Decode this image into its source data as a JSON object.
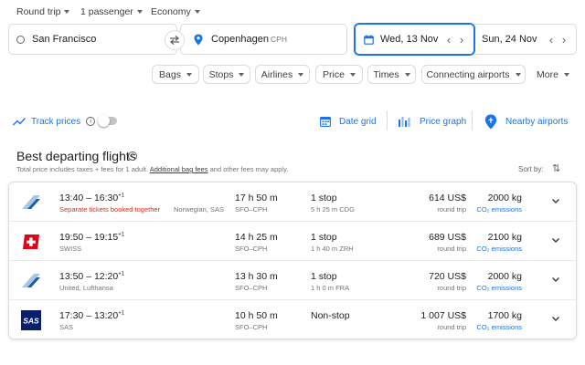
{
  "search": {
    "trip_type": "Round trip",
    "passengers": "1 passenger",
    "cabin": "Economy",
    "origin": "San Francisco",
    "destination": "Copenhagen",
    "destination_code": "CPH",
    "depart_date": "Wed, 13 Nov",
    "return_date": "Sun, 24 Nov"
  },
  "filters": [
    "Bags",
    "Stops",
    "Airlines",
    "Price",
    "Times",
    "Connecting airports",
    "More"
  ],
  "tools": {
    "track_prices": "Track prices",
    "date_grid": "Date grid",
    "price_graph": "Price graph",
    "nearby_airports": "Nearby airports"
  },
  "section": {
    "title": "Best departing flights",
    "subtitle_pre": "Total price includes taxes + fees for 1 adult.",
    "subtitle_link": "Additional bag fees",
    "subtitle_post": "and other fees may apply.",
    "sort_by": "Sort by:"
  },
  "flights": [
    {
      "logo": "norwegian-logo",
      "time_range": "13:40 – 16:30",
      "day_offset": "+1",
      "warning": "Separate tickets booked together",
      "airline": "Norwegian, SAS",
      "duration": "17 h 50 m",
      "route": "SFO–CPH",
      "stops": "1 stop",
      "layover": "5 h 25 m CDG",
      "price": "614 US$",
      "price_note": "round trip",
      "co2": "2000 kg",
      "co2_label": "CO₂ emissions"
    },
    {
      "logo": "swiss-logo",
      "time_range": "19:50 – 19:15",
      "day_offset": "+1",
      "airline": "SWISS",
      "duration": "14 h 25 m",
      "route": "SFO–CPH",
      "stops": "1 stop",
      "layover": "1 h 40 m ZRH",
      "price": "689 US$",
      "price_note": "round trip",
      "co2": "2100 kg",
      "co2_label": "CO₂ emissions"
    },
    {
      "logo": "united-lufthansa-logo",
      "time_range": "13:50 – 12:20",
      "day_offset": "+1",
      "airline": "United, Lufthansa",
      "duration": "13 h 30 m",
      "route": "SFO–CPH",
      "stops": "1 stop",
      "layover": "1 h 0 m FRA",
      "price": "720 US$",
      "price_note": "round trip",
      "co2": "2000 kg",
      "co2_label": "CO₂ emissions"
    },
    {
      "logo": "sas-logo",
      "logo_text": "SAS",
      "time_range": "17:30 – 13:20",
      "day_offset": "+1",
      "airline": "SAS",
      "duration": "10 h 50 m",
      "route": "SFO–CPH",
      "stops": "Non-stop",
      "layover": "",
      "price": "1 007 US$",
      "price_note": "round trip",
      "co2": "1700 kg",
      "co2_label": "CO₂ emissions"
    }
  ],
  "colors": {
    "accent": "#1a73e8",
    "warning": "#d93025",
    "swiss_red": "#e2001a",
    "sas_blue": "#0a1f6b",
    "norwegian_sky": "#a7c6e5"
  }
}
